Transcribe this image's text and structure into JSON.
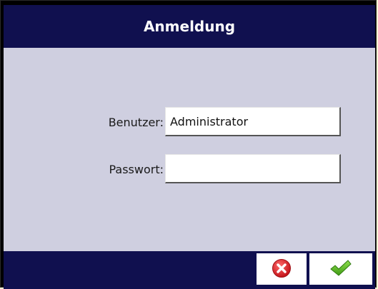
{
  "dialog": {
    "title": "Anmeldung"
  },
  "form": {
    "user_label": "Benutzer:",
    "user_value": "Administrator",
    "password_label": "Passwort:",
    "password_value": ""
  },
  "buttons": {
    "cancel_icon": "close-icon",
    "ok_icon": "check-icon"
  },
  "colors": {
    "titlebar": "#10104f",
    "background": "#cfcfe0",
    "cancel_red": "#e0262b",
    "ok_green": "#5fbf2a"
  }
}
